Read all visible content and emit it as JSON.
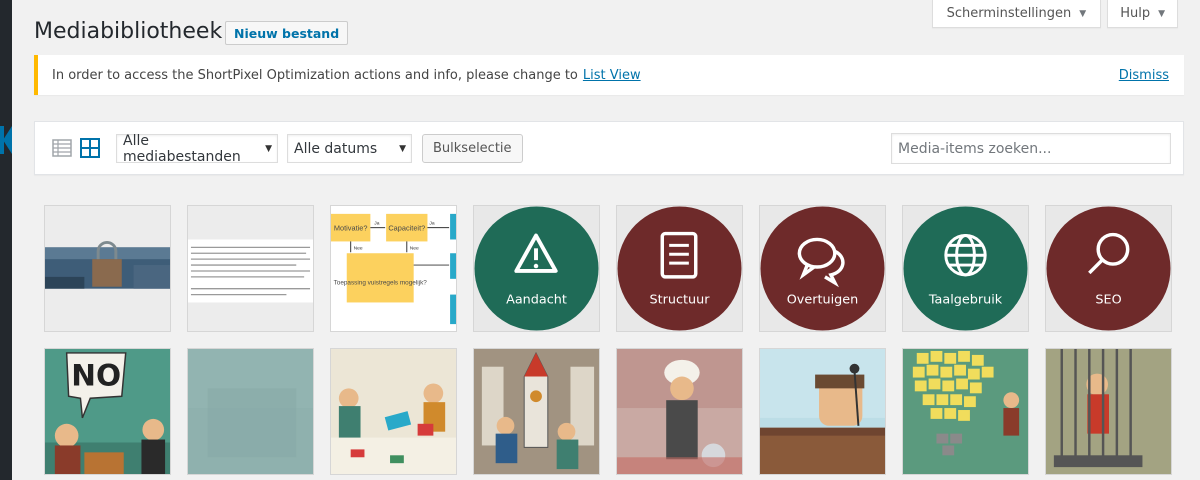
{
  "screen_options": {
    "label": "Scherminstellingen",
    "help": "Hulp"
  },
  "page": {
    "title": "Mediabibliotheek",
    "add_new": "Nieuw bestand"
  },
  "notice": {
    "text": "In order to access the ShortPixel Optimization actions and info, please change to",
    "link": "List View",
    "dismiss": "Dismiss"
  },
  "toolbar": {
    "type_filter": "Alle mediabestanden",
    "date_filter": "Alle datums",
    "bulk": "Bulkselectie",
    "search_placeholder": "Media-items zoeken..."
  },
  "media": {
    "row1": [
      {
        "kind": "photo-banner",
        "label": ""
      },
      {
        "kind": "text-doc",
        "label": ""
      },
      {
        "kind": "flowchart",
        "label": "",
        "boxes": [
          "Motivatie?",
          "Capaciteit?",
          "Toepassing vuistregels mogelijk?"
        ],
        "arrows": [
          "Ja",
          "Nee",
          "Nee",
          "Ja"
        ]
      },
      {
        "kind": "circle",
        "label": "Aandacht",
        "color": "#1f6b57",
        "icon": "warning-icon"
      },
      {
        "kind": "circle",
        "label": "Structuur",
        "color": "#6e2a2a",
        "icon": "document-icon"
      },
      {
        "kind": "circle",
        "label": "Overtuigen",
        "color": "#6e2a2a",
        "icon": "chat-icon"
      },
      {
        "kind": "circle",
        "label": "Taalgebruik",
        "color": "#1f6b57",
        "icon": "globe-icon"
      },
      {
        "kind": "circle",
        "label": "SEO",
        "color": "#6e2a2a",
        "icon": "search-icon"
      }
    ],
    "row2": [
      {
        "kind": "illustration-no",
        "text": "NO"
      },
      {
        "kind": "texture"
      },
      {
        "kind": "illustration-puzzle"
      },
      {
        "kind": "illustration-rocket"
      },
      {
        "kind": "illustration-turban"
      },
      {
        "kind": "illustration-podium"
      },
      {
        "kind": "illustration-bulb"
      },
      {
        "kind": "illustration-cage"
      }
    ]
  }
}
